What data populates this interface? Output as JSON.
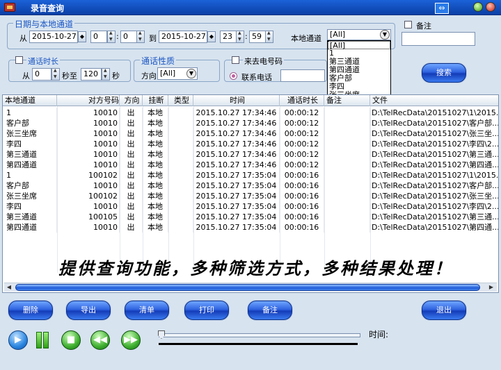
{
  "window": {
    "title": "录音查询"
  },
  "date_group": {
    "title": "日期与本地通道",
    "from_label": "从",
    "from_date": "2015-10-27",
    "from_hour": "0",
    "from_min": "0",
    "to_label": "到",
    "to_date": "2015-10-27",
    "to_hour": "23",
    "to_min": "59",
    "channel_label": "本地通道",
    "channel_value": "[All]",
    "channel_options": [
      "[All]",
      "1",
      "第三通道",
      "第四通道",
      "客户部",
      "李四",
      "张三坐席"
    ]
  },
  "remark": {
    "label": "备注",
    "value": ""
  },
  "duration_group": {
    "title": "通话时长",
    "from_label": "从",
    "from_value": "0",
    "mid_label": "秒至",
    "to_value": "120",
    "unit_label": "秒"
  },
  "nature_group": {
    "title": "通话性质",
    "dir_label": "方向",
    "dir_value": "[All]"
  },
  "caller_group": {
    "title": "来去电号码",
    "contact_label": "联系电话",
    "contact_value": ""
  },
  "search_button": "搜索",
  "table": {
    "columns": [
      "本地通道",
      "对方号码",
      "方向",
      "挂断",
      "类型",
      "时间",
      "通话时长",
      "备注",
      "文件"
    ],
    "rows": [
      [
        "1",
        "10010",
        "出",
        "本地",
        "",
        "2015.10.27 17:34:46",
        "00:00:12",
        "",
        "D:\\TelRecData\\20151027\\1\\2015..."
      ],
      [
        "客户部",
        "10010",
        "出",
        "本地",
        "",
        "2015.10.27 17:34:46",
        "00:00:12",
        "",
        "D:\\TelRecData\\20151027\\客户部..."
      ],
      [
        "张三坐席",
        "10010",
        "出",
        "本地",
        "",
        "2015.10.27 17:34:46",
        "00:00:12",
        "",
        "D:\\TelRecData\\20151027\\张三坐..."
      ],
      [
        "李四",
        "10010",
        "出",
        "本地",
        "",
        "2015.10.27 17:34:46",
        "00:00:12",
        "",
        "D:\\TelRecData\\20151027\\李四\\2..."
      ],
      [
        "第三通道",
        "10010",
        "出",
        "本地",
        "",
        "2015.10.27 17:34:46",
        "00:00:12",
        "",
        "D:\\TelRecData\\20151027\\第三通..."
      ],
      [
        "第四通道",
        "10010",
        "出",
        "本地",
        "",
        "2015.10.27 17:34:46",
        "00:00:12",
        "",
        "D:\\TelRecData\\20151027\\第四通..."
      ],
      [
        "1",
        "100102",
        "出",
        "本地",
        "",
        "2015.10.27 17:35:04",
        "00:00:16",
        "",
        "D:\\TelRecData\\20151027\\1\\2015..."
      ],
      [
        "客户部",
        "10010",
        "出",
        "本地",
        "",
        "2015.10.27 17:35:04",
        "00:00:16",
        "",
        "D:\\TelRecData\\20151027\\客户部..."
      ],
      [
        "张三坐席",
        "100102",
        "出",
        "本地",
        "",
        "2015.10.27 17:35:04",
        "00:00:16",
        "",
        "D:\\TelRecData\\20151027\\张三坐..."
      ],
      [
        "李四",
        "10010",
        "出",
        "本地",
        "",
        "2015.10.27 17:35:04",
        "00:00:16",
        "",
        "D:\\TelRecData\\20151027\\李四\\2..."
      ],
      [
        "第三通道",
        "100105",
        "出",
        "本地",
        "",
        "2015.10.27 17:35:04",
        "00:00:16",
        "",
        "D:\\TelRecData\\20151027\\第三通..."
      ],
      [
        "第四通道",
        "10010",
        "出",
        "本地",
        "",
        "2015.10.27 17:35:04",
        "00:00:16",
        "",
        "D:\\TelRecData\\20151027\\第四通..."
      ]
    ]
  },
  "slogan": "提供查询功能，多种筛选方式，多种结果处理！",
  "buttons": {
    "delete": "删除",
    "export": "导出",
    "list": "清单",
    "print": "打印",
    "remark": "备注",
    "exit": "退出"
  },
  "player": {
    "time_label": "时间:",
    "progress": 0
  },
  "icons": {
    "play": "play-icon",
    "pause": "pause-icon",
    "stop": "stop-icon",
    "prev": "rewind-icon",
    "next": "forward-icon",
    "swap": "swap-icon"
  }
}
